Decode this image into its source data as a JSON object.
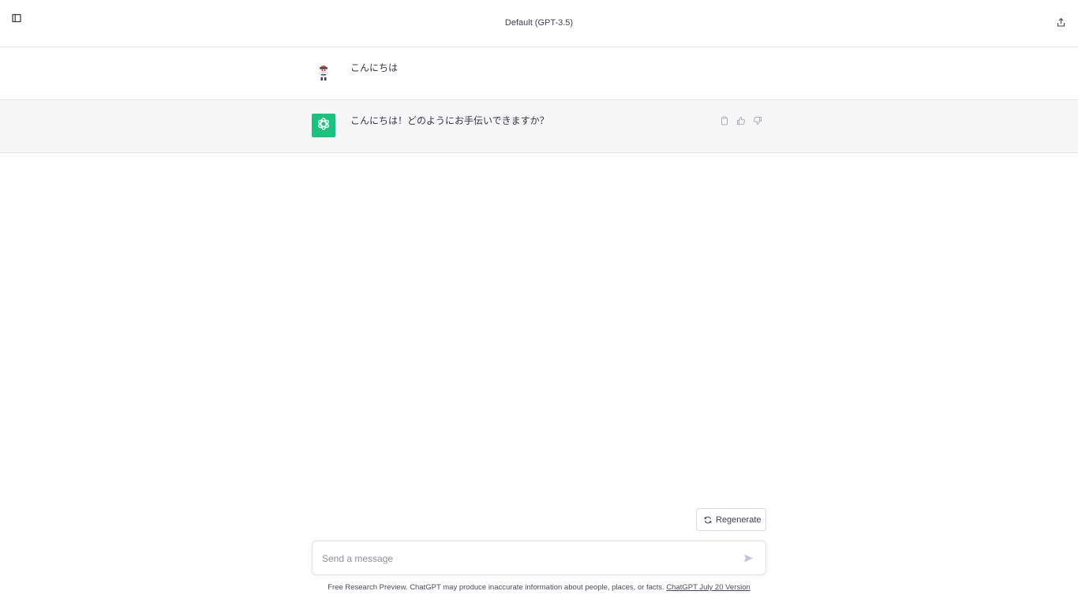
{
  "header": {
    "model_title": "Default (GPT-3.5)"
  },
  "conversation": {
    "messages": [
      {
        "role": "user",
        "text": "こんにちは"
      },
      {
        "role": "assistant",
        "text": "こんにちは！どのようにお手伝いできますか？"
      }
    ]
  },
  "controls": {
    "regenerate_label": "Regenerate"
  },
  "composer": {
    "placeholder": "Send a message",
    "value": ""
  },
  "footer": {
    "disclaimer": "Free Research Preview. ChatGPT may produce inaccurate information about people, places, or facts. ",
    "version_link": "ChatGPT July 20 Version"
  },
  "colors": {
    "assistant_avatar_bg": "#19c37d",
    "assistant_row_bg": "#f7f7f8"
  },
  "icons": [
    "sidebar-toggle-icon",
    "share-icon",
    "openai-logo-icon",
    "copy-icon",
    "thumbs-up-icon",
    "thumbs-down-icon",
    "refresh-icon",
    "send-icon"
  ]
}
